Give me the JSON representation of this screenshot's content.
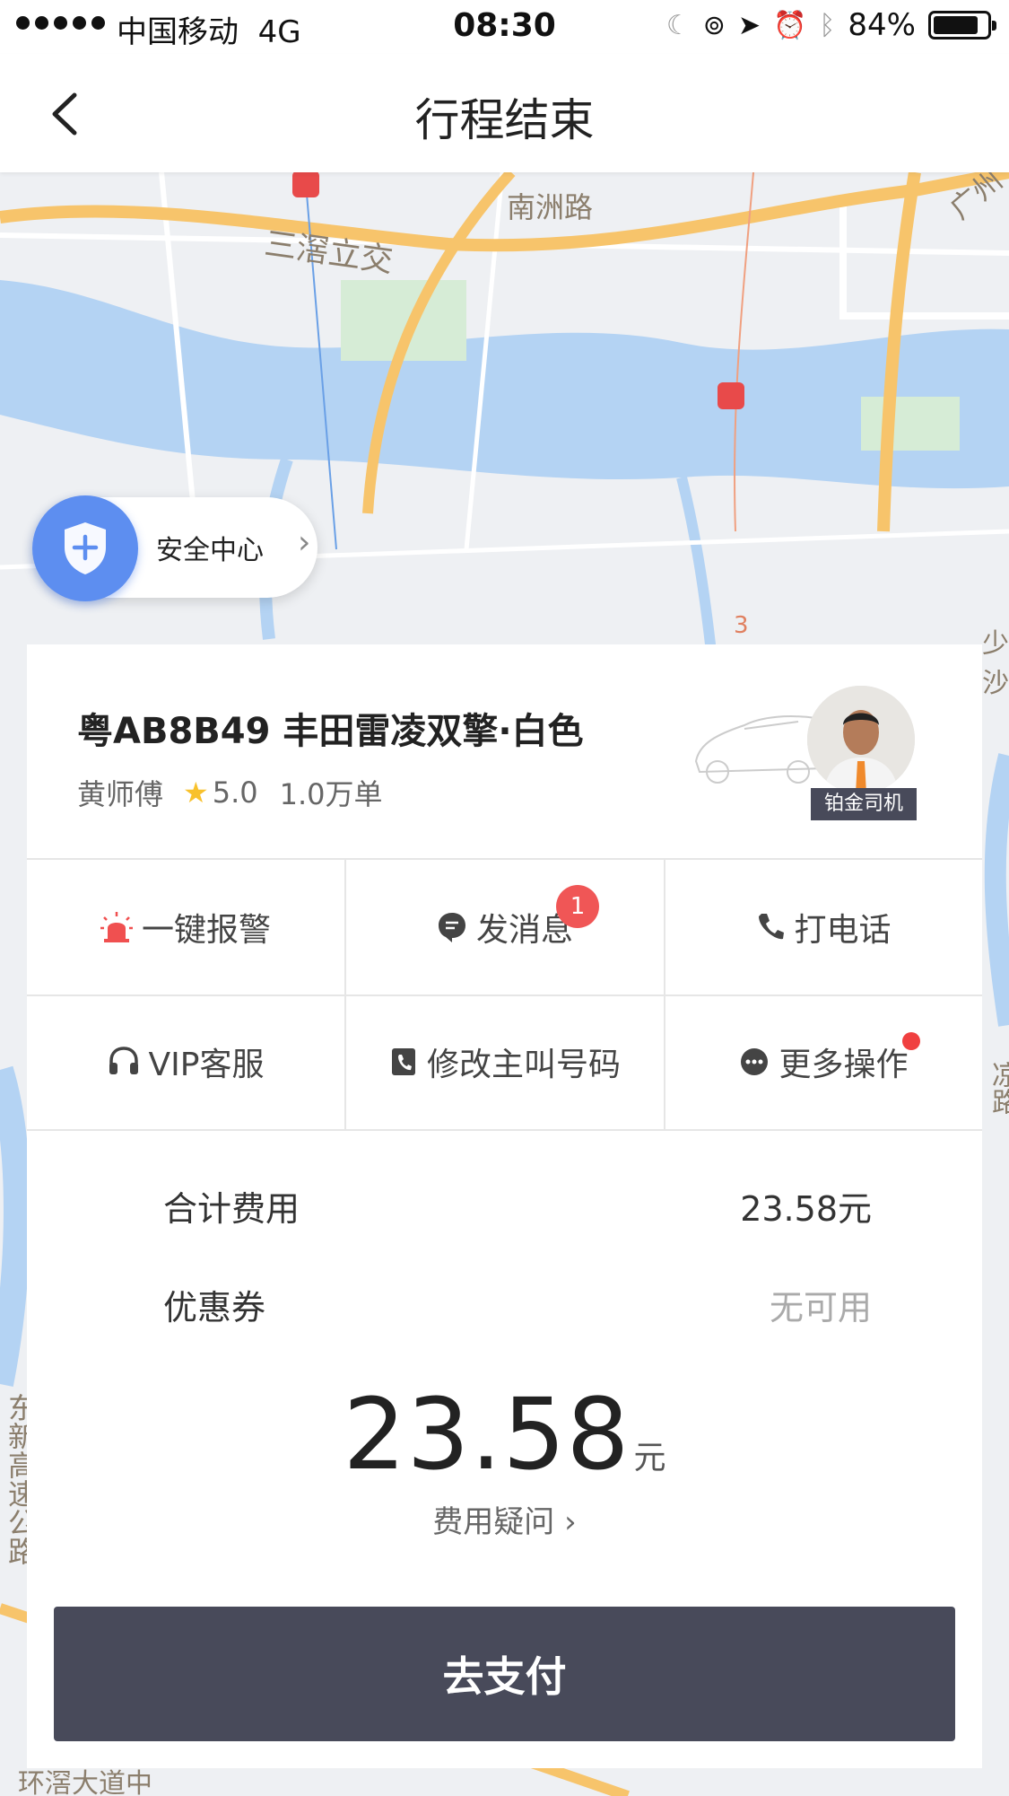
{
  "status_bar": {
    "carrier": "中国移动",
    "network": "4G",
    "time": "08:30",
    "battery_percent": "84%",
    "battery_level": 0.84
  },
  "nav": {
    "title": "行程结束"
  },
  "map": {
    "labels": [
      "南洲路",
      "三滘立交",
      "广州",
      "少沙",
      "凉路",
      "东新高速公路",
      "环滘大道中"
    ],
    "metro_marker": "3"
  },
  "safety": {
    "label": "安全中心"
  },
  "driver": {
    "plate_and_car": "粤AB8B49  丰田雷凌双擎·白色",
    "name": "黄师傅",
    "rating": "5.0",
    "orders": "1.0万单",
    "badge": "铂金司机"
  },
  "actions": {
    "alarm": "一键报警",
    "message": "发消息",
    "message_badge": "1",
    "call": "打电话",
    "vip": "VIP客服",
    "change_number": "修改主叫号码",
    "more": "更多操作"
  },
  "fees": {
    "total_label": "合计费用",
    "total_value": "23.58元",
    "coupon_label": "优惠券",
    "coupon_value": "无可用",
    "amount": "23.58",
    "amount_unit": "元",
    "question": "费用疑问"
  },
  "pay_button": "去支付",
  "colors": {
    "accent_blue": "#5d8ef0",
    "dark_button": "#484a5a",
    "badge_red": "#f05656",
    "star_yellow": "#f8c12c",
    "alarm_red": "#f05050",
    "road_orange": "#f7c46b",
    "river_blue": "#b4d3f3"
  }
}
